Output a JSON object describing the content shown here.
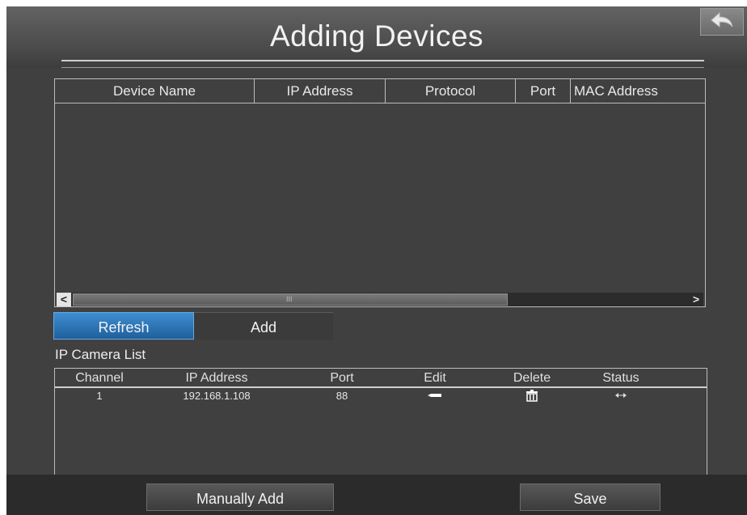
{
  "header": {
    "title": "Adding Devices",
    "back_icon": "back-arrow-icon"
  },
  "device_table": {
    "columns": [
      "Device Name",
      "IP Address",
      "Protocol",
      "Port",
      "MAC Address"
    ],
    "rows": [],
    "scrollbar": {
      "left_arrow": "<",
      "right_arrow": ">",
      "grip": "III"
    }
  },
  "tabs": {
    "refresh": "Refresh",
    "add": "Add",
    "active": "Refresh",
    "active_color": "#2f77b8"
  },
  "camera_list": {
    "label": "IP Camera List",
    "columns": [
      "Channel",
      "IP Address",
      "Port",
      "Edit",
      "Delete",
      "Status"
    ],
    "rows": [
      {
        "channel": "1",
        "ip_address": "192.168.1.108",
        "port": "88",
        "edit_icon": "edit-icon",
        "delete_icon": "trash-icon",
        "status_icon": "connection-status-icon"
      }
    ]
  },
  "footer": {
    "manually_add": "Manually Add",
    "save": "Save"
  }
}
